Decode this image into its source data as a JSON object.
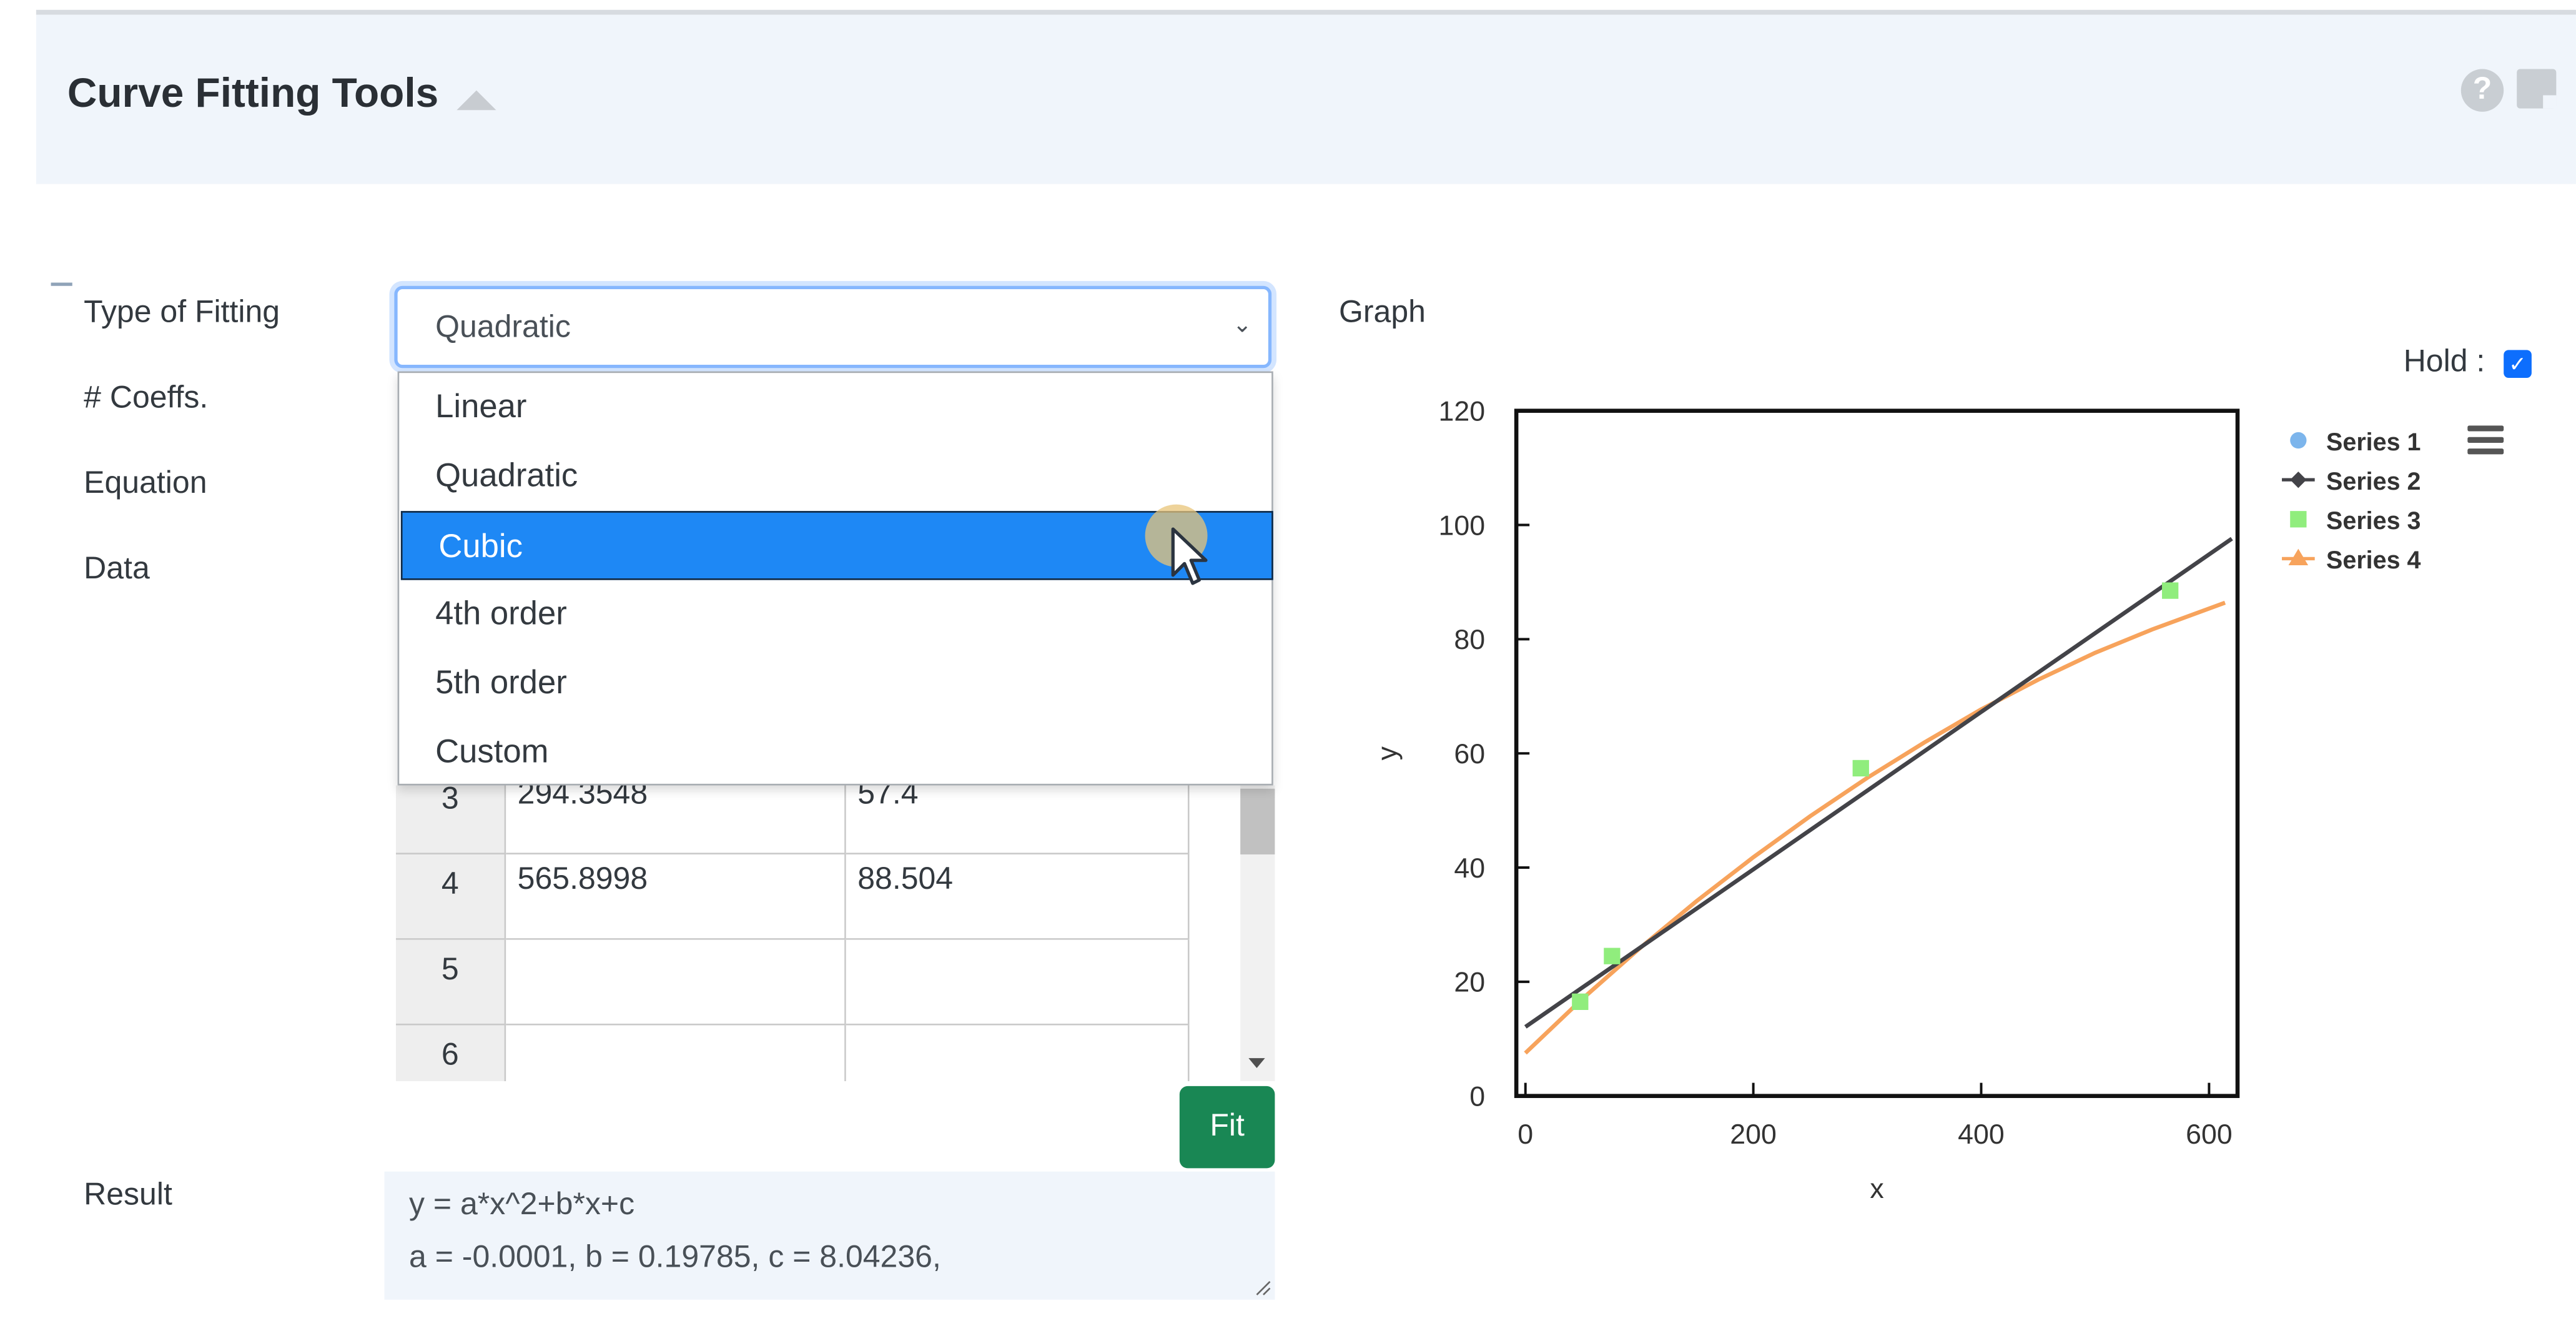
{
  "header": {
    "title": "Curve Fitting Tools",
    "help_glyph": "?",
    "icons": [
      "chevron-up-icon",
      "help-icon",
      "note-icon"
    ]
  },
  "form": {
    "labels": {
      "type_of_fitting": "Type of Fitting",
      "coeffs": "# Coeffs.",
      "equation": "Equation",
      "data": "Data",
      "result": "Result",
      "graph": "Graph"
    },
    "fitting_select": {
      "value": "Quadratic",
      "options": [
        "Linear",
        "Quadratic",
        "Cubic",
        "4th order",
        "5th order",
        "Custom"
      ],
      "hovered_option": "Cubic"
    }
  },
  "table": {
    "rows": [
      {
        "index": "3",
        "x": "294.3548",
        "y": "57.4"
      },
      {
        "index": "4",
        "x": "565.8998",
        "y": "88.504"
      },
      {
        "index": "5",
        "x": "",
        "y": ""
      },
      {
        "index": "6",
        "x": "",
        "y": ""
      }
    ]
  },
  "fit_button": "Fit",
  "result": {
    "line1": "y = a*x^2+b*x+c",
    "line2": "a = -0.0001, b = 0.19785, c = 8.04236,"
  },
  "hold": {
    "label": "Hold :",
    "checked": true
  },
  "colors": {
    "accent": "#0d6efd",
    "fit_button": "#198754",
    "series1": "#7cb5ec",
    "series2": "#434348",
    "series3": "#90ed7d",
    "series4": "#f7a35c"
  },
  "chart_data": {
    "type": "scatter",
    "title": "",
    "xlabel": "x",
    "ylabel": "y",
    "xlim": [
      -8,
      625
    ],
    "ylim": [
      0,
      120
    ],
    "x_ticks": [
      0,
      200,
      400,
      600
    ],
    "y_ticks": [
      0,
      20,
      40,
      60,
      80,
      100,
      120
    ],
    "grid": false,
    "legend_position": "right",
    "series": [
      {
        "name": "Series 1",
        "kind": "scatter",
        "marker": "circle",
        "points": []
      },
      {
        "name": "Series 2",
        "kind": "line",
        "marker": "diamond",
        "x": [
          0,
          620
        ],
        "y": [
          12.1,
          97.6
        ]
      },
      {
        "name": "Series 3",
        "kind": "scatter",
        "marker": "square",
        "x": [
          48,
          76,
          294.3548,
          565.8998
        ],
        "y": [
          16.5,
          24.5,
          57.4,
          88.504
        ]
      },
      {
        "name": "Series 4",
        "kind": "line",
        "marker": "triangle",
        "x": [
          0,
          50,
          100,
          150,
          200,
          250,
          300,
          350,
          400,
          450,
          500,
          550,
          614
        ],
        "y": [
          7.5,
          17.0,
          25.8,
          34.1,
          41.8,
          49.0,
          55.7,
          61.9,
          67.7,
          72.9,
          77.6,
          81.7,
          86.4
        ]
      }
    ]
  }
}
